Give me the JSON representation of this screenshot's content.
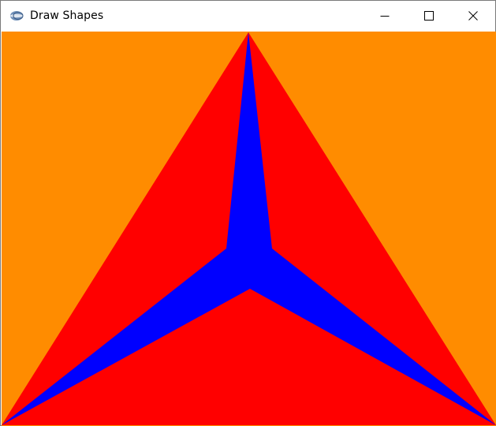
{
  "window": {
    "title": "Draw Shapes",
    "app_icon": "eclipse-app-icon",
    "controls": {
      "minimize_icon": "minimize-icon",
      "maximize_icon": "maximize-icon",
      "close_icon": "close-icon"
    }
  },
  "canvas": {
    "background_color": "#FF8C00",
    "shapes": [
      {
        "name": "red-triangle",
        "kind": "polygon",
        "fill": "#FF0000"
      },
      {
        "name": "blue-three-point-star",
        "kind": "polygon",
        "fill": "#0000FF"
      }
    ]
  }
}
